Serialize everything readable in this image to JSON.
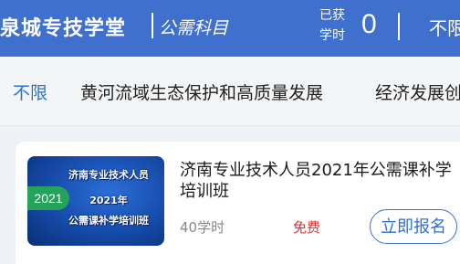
{
  "header": {
    "brand": "泉城专技学堂",
    "subtitle": "公需科目",
    "hours_label_line1": "已获",
    "hours_label_line2": "学时",
    "hours_value": "0",
    "right_text": "不限"
  },
  "tabs": [
    {
      "label": "不限",
      "active": true
    },
    {
      "label": "黄河流域生态保护和高质量发展",
      "active": false
    },
    {
      "label": "经济发展创",
      "active": false
    }
  ],
  "course": {
    "thumb_line1": "济南专业技术人员",
    "thumb_line2": "2021年",
    "thumb_line3": "公需课补学培训班",
    "year_badge": "2021",
    "title": "济南专业技术人员2021年公需课补学培训班",
    "hours": "40学时",
    "price": "免费",
    "enroll_label": "立即报名"
  },
  "colors": {
    "header_bg": "#3f70ce",
    "accent": "#2f6fd4",
    "price": "#e0322f",
    "badge": "#25a35a"
  }
}
